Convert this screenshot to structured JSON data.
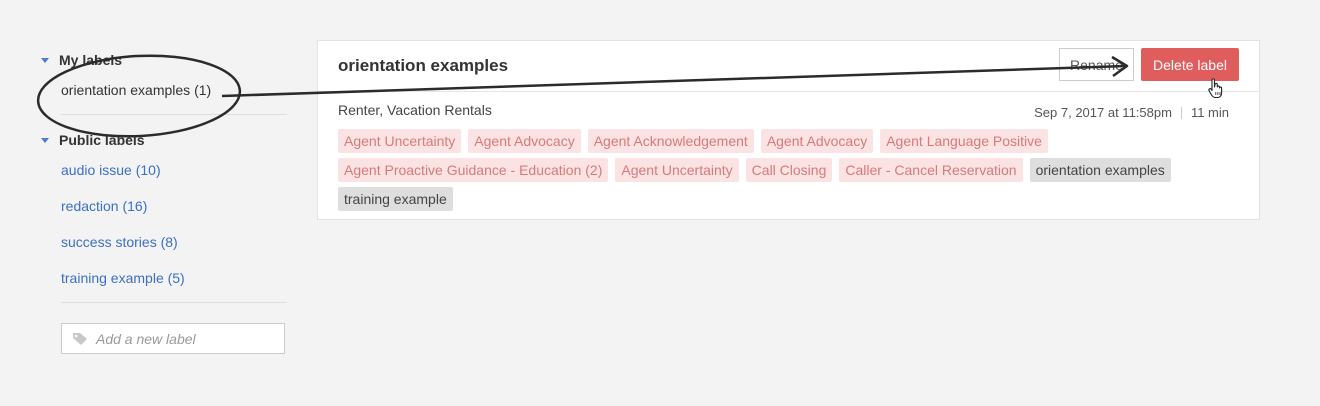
{
  "sidebar": {
    "my_labels_header": "My labels",
    "my_labels": [
      "orientation examples (1)"
    ],
    "public_labels_header": "Public labels",
    "public_labels": [
      "audio issue (10)",
      "redaction (16)",
      "success stories (8)",
      "training example (5)"
    ],
    "add_label_placeholder": "Add a new label"
  },
  "card": {
    "title": "orientation examples",
    "rename_button": "Rename",
    "delete_button": "Delete label",
    "call_name": "Renter, Vacation Rentals",
    "date": "Sep 7, 2017 at 11:58pm",
    "duration": "11 min",
    "tags": [
      {
        "text": "Agent Uncertainty",
        "style": "red"
      },
      {
        "text": "Agent Advocacy",
        "style": "red"
      },
      {
        "text": "Agent Acknowledgement",
        "style": "red"
      },
      {
        "text": "Agent Advocacy",
        "style": "red"
      },
      {
        "text": "Agent Language Positive",
        "style": "red"
      },
      {
        "text": "Agent Proactive Guidance - Education (2)",
        "style": "red"
      },
      {
        "text": "Agent Uncertainty",
        "style": "red"
      },
      {
        "text": "Call Closing",
        "style": "red"
      },
      {
        "text": "Caller - Cancel Reservation",
        "style": "red"
      },
      {
        "text": "orientation examples",
        "style": "gray"
      },
      {
        "text": "training example",
        "style": "gray"
      }
    ]
  },
  "colors": {
    "accent_blue": "#3b6fc4",
    "delete_red": "#e05d5d",
    "tag_red_bg": "#fbe3e3",
    "tag_red_text": "#d77a7a",
    "tag_gray_bg": "#dedede"
  },
  "annotation": {
    "shapes": [
      "ellipse",
      "arrow"
    ],
    "icon": "hand-pointer-icon"
  }
}
